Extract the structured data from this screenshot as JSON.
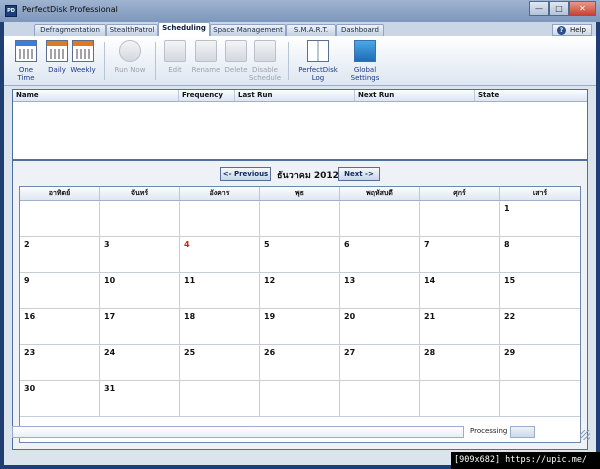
{
  "window": {
    "title": "PerfectDisk Professional",
    "min_glyph": "—",
    "max_glyph": "□",
    "close_glyph": "✕",
    "app_icon_text": "PD"
  },
  "tabs": [
    {
      "label": "Defragmentation",
      "active": false
    },
    {
      "label": "StealthPatrol",
      "active": false
    },
    {
      "label": "Scheduling",
      "active": true
    },
    {
      "label": "Space Management",
      "active": false
    },
    {
      "label": "S.M.A.R.T.",
      "active": false
    },
    {
      "label": "Dashboard",
      "active": false
    }
  ],
  "help": {
    "label": "Help",
    "icon_glyph": "?"
  },
  "toolbar": {
    "one_time": "One Time",
    "daily": "Daily",
    "weekly": "Weekly",
    "run_now": "Run Now",
    "edit": "Edit",
    "rename": "Rename",
    "delete": "Delete",
    "disable_schedule_1": "Disable",
    "disable_schedule_2": "Schedule",
    "log_1": "PerfectDisk",
    "log_2": "Log",
    "global_settings": "Global Settings"
  },
  "jobs_table": {
    "columns": [
      "Name",
      "Frequency",
      "Last Run",
      "Next Run",
      "State"
    ],
    "rows": []
  },
  "calendar": {
    "prev_label": "<- Previous",
    "next_label": "Next ->",
    "month_label": "ธันวาคม 2012",
    "weekdays": [
      "อาทิตย์",
      "จันทร์",
      "อังคาร",
      "พุธ",
      "พฤหัสบดี",
      "ศุกร์",
      "เสาร์"
    ],
    "weeks": [
      [
        "",
        "",
        "",
        "",
        "",
        "",
        "1"
      ],
      [
        "2",
        "3",
        "4",
        "5",
        "6",
        "7",
        "8"
      ],
      [
        "9",
        "10",
        "11",
        "12",
        "13",
        "14",
        "15"
      ],
      [
        "16",
        "17",
        "18",
        "19",
        "20",
        "21",
        "22"
      ],
      [
        "23",
        "24",
        "25",
        "26",
        "27",
        "28",
        "29"
      ],
      [
        "30",
        "31",
        "",
        "",
        "",
        "",
        ""
      ]
    ],
    "highlight_day": "4",
    "highlight_color": "#d51a1a"
  },
  "status": {
    "text": "Processing"
  },
  "watermark": "[909x682] https://upic.me/"
}
